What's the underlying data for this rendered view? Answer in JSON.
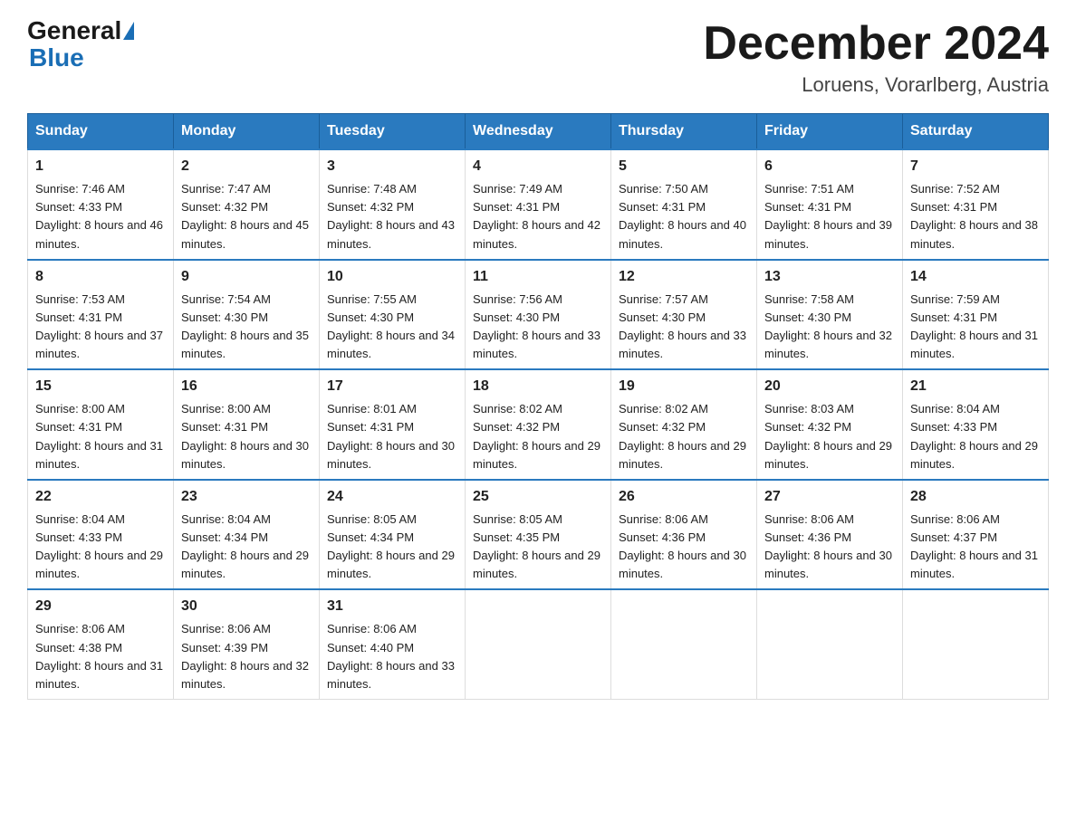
{
  "header": {
    "logo_general": "General",
    "logo_blue": "Blue",
    "month_title": "December 2024",
    "location": "Loruens, Vorarlberg, Austria"
  },
  "days_of_week": [
    "Sunday",
    "Monday",
    "Tuesday",
    "Wednesday",
    "Thursday",
    "Friday",
    "Saturday"
  ],
  "weeks": [
    [
      {
        "day": "1",
        "sunrise": "7:46 AM",
        "sunset": "4:33 PM",
        "daylight": "8 hours and 46 minutes."
      },
      {
        "day": "2",
        "sunrise": "7:47 AM",
        "sunset": "4:32 PM",
        "daylight": "8 hours and 45 minutes."
      },
      {
        "day": "3",
        "sunrise": "7:48 AM",
        "sunset": "4:32 PM",
        "daylight": "8 hours and 43 minutes."
      },
      {
        "day": "4",
        "sunrise": "7:49 AM",
        "sunset": "4:31 PM",
        "daylight": "8 hours and 42 minutes."
      },
      {
        "day": "5",
        "sunrise": "7:50 AM",
        "sunset": "4:31 PM",
        "daylight": "8 hours and 40 minutes."
      },
      {
        "day": "6",
        "sunrise": "7:51 AM",
        "sunset": "4:31 PM",
        "daylight": "8 hours and 39 minutes."
      },
      {
        "day": "7",
        "sunrise": "7:52 AM",
        "sunset": "4:31 PM",
        "daylight": "8 hours and 38 minutes."
      }
    ],
    [
      {
        "day": "8",
        "sunrise": "7:53 AM",
        "sunset": "4:31 PM",
        "daylight": "8 hours and 37 minutes."
      },
      {
        "day": "9",
        "sunrise": "7:54 AM",
        "sunset": "4:30 PM",
        "daylight": "8 hours and 35 minutes."
      },
      {
        "day": "10",
        "sunrise": "7:55 AM",
        "sunset": "4:30 PM",
        "daylight": "8 hours and 34 minutes."
      },
      {
        "day": "11",
        "sunrise": "7:56 AM",
        "sunset": "4:30 PM",
        "daylight": "8 hours and 33 minutes."
      },
      {
        "day": "12",
        "sunrise": "7:57 AM",
        "sunset": "4:30 PM",
        "daylight": "8 hours and 33 minutes."
      },
      {
        "day": "13",
        "sunrise": "7:58 AM",
        "sunset": "4:30 PM",
        "daylight": "8 hours and 32 minutes."
      },
      {
        "day": "14",
        "sunrise": "7:59 AM",
        "sunset": "4:31 PM",
        "daylight": "8 hours and 31 minutes."
      }
    ],
    [
      {
        "day": "15",
        "sunrise": "8:00 AM",
        "sunset": "4:31 PM",
        "daylight": "8 hours and 31 minutes."
      },
      {
        "day": "16",
        "sunrise": "8:00 AM",
        "sunset": "4:31 PM",
        "daylight": "8 hours and 30 minutes."
      },
      {
        "day": "17",
        "sunrise": "8:01 AM",
        "sunset": "4:31 PM",
        "daylight": "8 hours and 30 minutes."
      },
      {
        "day": "18",
        "sunrise": "8:02 AM",
        "sunset": "4:32 PM",
        "daylight": "8 hours and 29 minutes."
      },
      {
        "day": "19",
        "sunrise": "8:02 AM",
        "sunset": "4:32 PM",
        "daylight": "8 hours and 29 minutes."
      },
      {
        "day": "20",
        "sunrise": "8:03 AM",
        "sunset": "4:32 PM",
        "daylight": "8 hours and 29 minutes."
      },
      {
        "day": "21",
        "sunrise": "8:04 AM",
        "sunset": "4:33 PM",
        "daylight": "8 hours and 29 minutes."
      }
    ],
    [
      {
        "day": "22",
        "sunrise": "8:04 AM",
        "sunset": "4:33 PM",
        "daylight": "8 hours and 29 minutes."
      },
      {
        "day": "23",
        "sunrise": "8:04 AM",
        "sunset": "4:34 PM",
        "daylight": "8 hours and 29 minutes."
      },
      {
        "day": "24",
        "sunrise": "8:05 AM",
        "sunset": "4:34 PM",
        "daylight": "8 hours and 29 minutes."
      },
      {
        "day": "25",
        "sunrise": "8:05 AM",
        "sunset": "4:35 PM",
        "daylight": "8 hours and 29 minutes."
      },
      {
        "day": "26",
        "sunrise": "8:06 AM",
        "sunset": "4:36 PM",
        "daylight": "8 hours and 30 minutes."
      },
      {
        "day": "27",
        "sunrise": "8:06 AM",
        "sunset": "4:36 PM",
        "daylight": "8 hours and 30 minutes."
      },
      {
        "day": "28",
        "sunrise": "8:06 AM",
        "sunset": "4:37 PM",
        "daylight": "8 hours and 31 minutes."
      }
    ],
    [
      {
        "day": "29",
        "sunrise": "8:06 AM",
        "sunset": "4:38 PM",
        "daylight": "8 hours and 31 minutes."
      },
      {
        "day": "30",
        "sunrise": "8:06 AM",
        "sunset": "4:39 PM",
        "daylight": "8 hours and 32 minutes."
      },
      {
        "day": "31",
        "sunrise": "8:06 AM",
        "sunset": "4:40 PM",
        "daylight": "8 hours and 33 minutes."
      },
      null,
      null,
      null,
      null
    ]
  ],
  "labels": {
    "sunrise_prefix": "Sunrise: ",
    "sunset_prefix": "Sunset: ",
    "daylight_prefix": "Daylight: "
  }
}
